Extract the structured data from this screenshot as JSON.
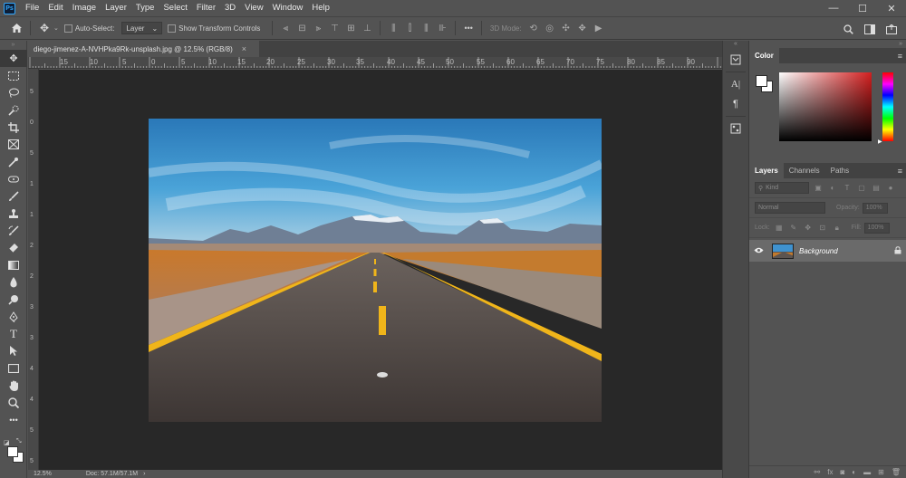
{
  "app": {
    "logo": "Ps"
  },
  "menu": [
    "File",
    "Edit",
    "Image",
    "Layer",
    "Type",
    "Select",
    "Filter",
    "3D",
    "View",
    "Window",
    "Help"
  ],
  "window_controls": {
    "minimize": "—",
    "maximize": "☐",
    "close": "✕"
  },
  "options": {
    "auto_select_label": "Auto-Select:",
    "layer_select_value": "Layer",
    "show_transform_label": "Show Transform Controls",
    "mode_3d_label": "3D Mode:",
    "more_label": "•••"
  },
  "document": {
    "tab_title": "diego-jimenez-A-NVHPka9Rk-unsplash.jpg @ 12.5% (RGB/8)",
    "tab_close": "×",
    "ruler_h": [
      "15",
      "10",
      "5",
      "0",
      "5",
      "10",
      "15",
      "20",
      "25",
      "30",
      "35",
      "40",
      "45",
      "50",
      "55",
      "60",
      "65",
      "70",
      "75",
      "80",
      "85",
      "90"
    ],
    "ruler_v": [
      "5",
      "0",
      "5",
      "1",
      "1",
      "2",
      "2",
      "3",
      "3",
      "4",
      "4",
      "5",
      "5"
    ],
    "zoom": "12.5%",
    "doc_size": "Doc: 57.1M/57.1M"
  },
  "panels": {
    "color": {
      "tab": "Color"
    },
    "layers": {
      "tabs": [
        "Layers",
        "Channels",
        "Paths"
      ],
      "kind_placeholder": "Kind",
      "blend_mode": "Normal",
      "opacity_label": "Opacity:",
      "opacity_value": "100%",
      "lock_label": "Lock:",
      "fill_label": "Fill:",
      "fill_value": "100%",
      "items": [
        {
          "name": "Background",
          "visible": true,
          "locked": true
        }
      ]
    }
  },
  "colors": {
    "foreground": "#ffffff",
    "background": "#ffffff",
    "accent": "#31a8ff"
  }
}
